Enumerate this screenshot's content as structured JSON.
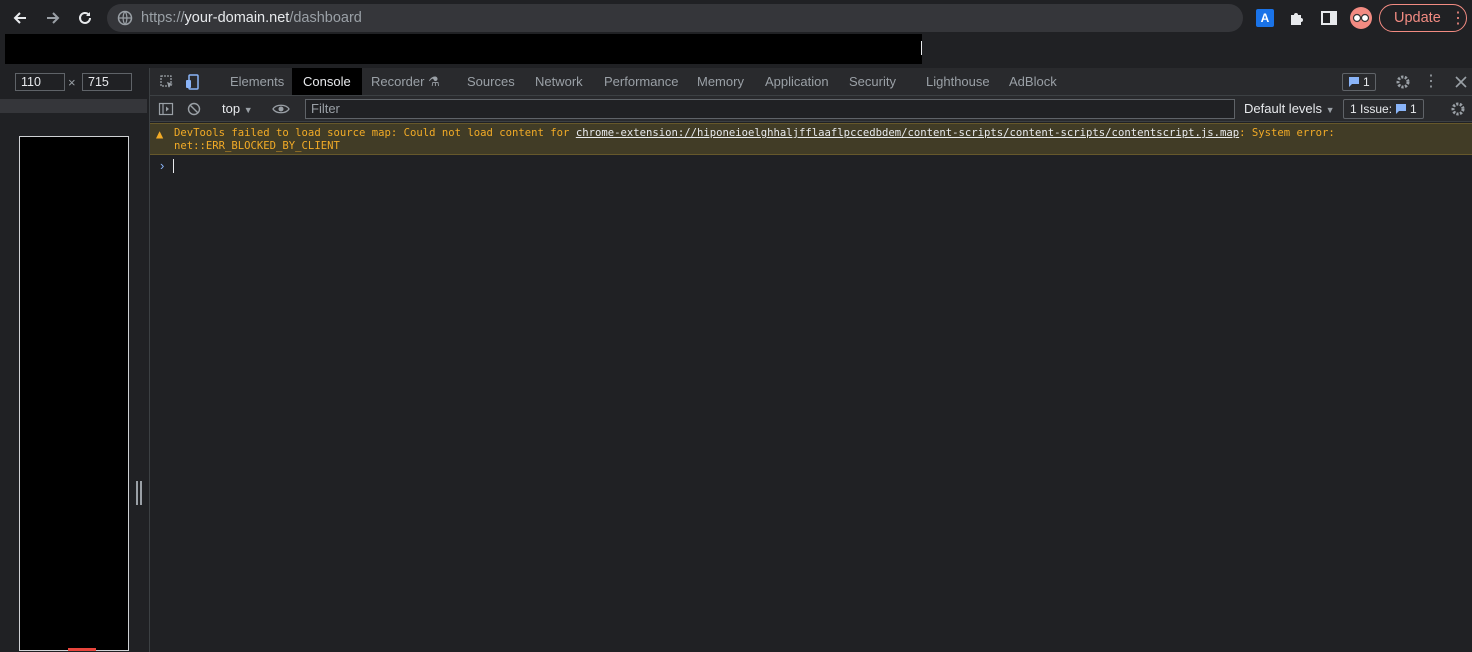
{
  "browser": {
    "url_scheme": "https://",
    "url_host": "your-domain.net",
    "url_path": "/dashboard",
    "ext_a_label": "A",
    "update_label": "Update"
  },
  "device": {
    "width_value": "110",
    "height_value": "715",
    "times_symbol": "×"
  },
  "devtools": {
    "tabs": [
      {
        "label": "Elements"
      },
      {
        "label": "Console"
      },
      {
        "label": "Recorder ⚗"
      },
      {
        "label": "Sources"
      },
      {
        "label": "Network"
      },
      {
        "label": "Performance"
      },
      {
        "label": "Memory"
      },
      {
        "label": "Application"
      },
      {
        "label": "Security"
      },
      {
        "label": "Lighthouse"
      },
      {
        "label": "AdBlock"
      }
    ],
    "active_tab": "Console",
    "message_count": "1"
  },
  "console": {
    "context": "top",
    "filter_placeholder": "Filter",
    "levels_label": "Default levels",
    "issues_label": "1 Issue:",
    "issues_count": "1",
    "warning": {
      "prefix": "DevTools failed to load source map: Could not load content for ",
      "link": "chrome-extension://hiponeioelghhaljfflaaflpccedbdem/content-scripts/content-scripts/contentscript.js.map",
      "suffix": ": System error:",
      "line2": "net::ERR_BLOCKED_BY_CLIENT"
    },
    "prompt_symbol": "›"
  },
  "colors": {
    "accent_blue": "#8ab4f8",
    "warning_text": "#f2ab26",
    "update_red": "#f28b82"
  }
}
